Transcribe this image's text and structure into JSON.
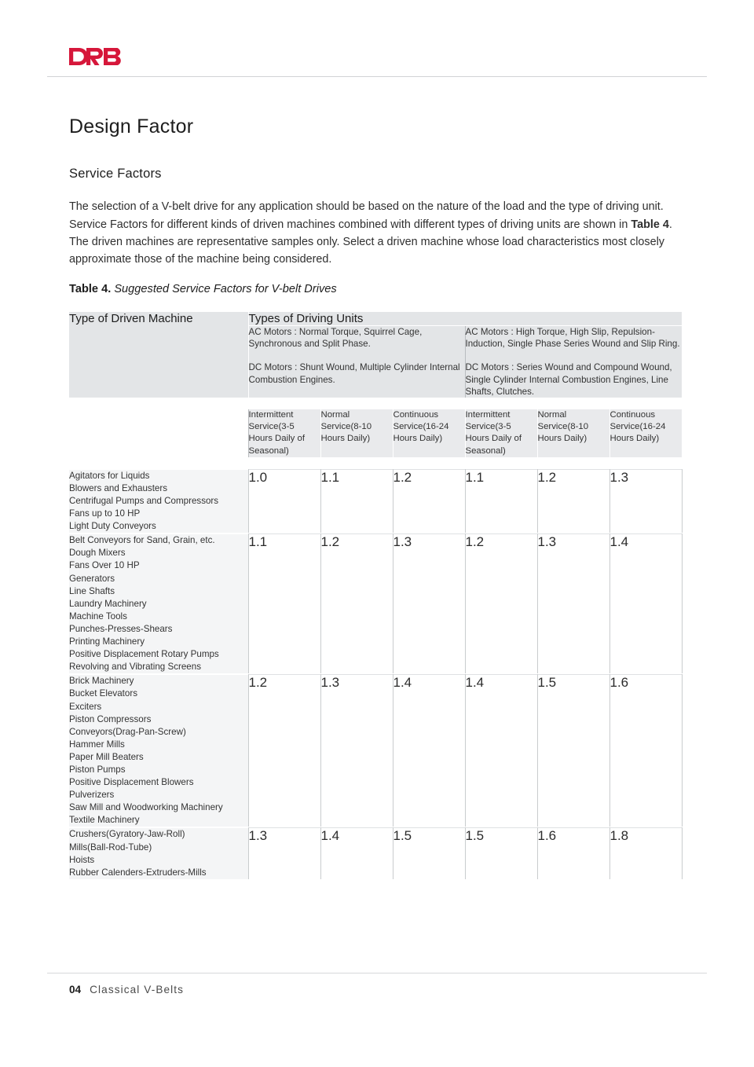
{
  "brand": {
    "logo_text": "DRB",
    "logo_color": "#d6173a"
  },
  "header": {
    "page_title": "Design Factor",
    "section_title": "Service Factors"
  },
  "intro": {
    "part1": "The selection of a V-belt drive for any application should be based on the nature of the load and the type of driving unit. Service Factors for different kinds of driven machines combined with different types of driving units are shown in ",
    "emphasis": "Table 4",
    "part2": ". The driven machines are representative samples only. Select a driven machine whose load characteristics most closely approximate those of the machine being considered."
  },
  "table_caption": {
    "label": "Table 4.",
    "text": " Suggested Service Factors for V-belt Drives"
  },
  "table": {
    "corner_label": "Type of Driven Machine",
    "driving_units_title": "Types of Driving Units",
    "groups": [
      {
        "ac_line": "AC Motors : Normal Torque, Squirrel Cage, Synchronous and Split Phase.",
        "dc_line": "DC Motors : Shunt Wound, Multiple Cylinder Internal Combustion Engines."
      },
      {
        "ac_line": "AC Motors : High Torque, High Slip, Repulsion-Induction, Single Phase Series Wound and Slip Ring.",
        "dc_line": "DC Motors : Series Wound and Compound Wound, Single Cylinder Internal Combustion Engines, Line Shafts, Clutches."
      }
    ],
    "sub_headers": [
      "Intermittent Service(3-5 Hours Daily of Seasonal)",
      "Normal Service(8-10 Hours Daily)",
      "Continuous Service(16-24 Hours Daily)",
      "Intermittent Service(3-5 Hours Daily of Seasonal)",
      "Normal Service(8-10 Hours Daily)",
      "Continuous Service(16-24 Hours Daily)"
    ],
    "rows": [
      {
        "machines": [
          "Agitators for Liquids",
          "Blowers and Exhausters",
          "Centrifugal Pumps and Compressors",
          "Fans up to 10 HP",
          "Light Duty Conveyors"
        ],
        "values": [
          "1.0",
          "1.1",
          "1.2",
          "1.1",
          "1.2",
          "1.3"
        ]
      },
      {
        "machines": [
          "Belt Conveyors for Sand, Grain, etc.",
          "Dough Mixers",
          "Fans Over 10 HP",
          "Generators",
          "Line Shafts",
          "Laundry Machinery",
          "Machine Tools",
          "Punches-Presses-Shears",
          "Printing Machinery",
          "Positive Displacement Rotary Pumps",
          "Revolving and Vibrating Screens"
        ],
        "values": [
          "1.1",
          "1.2",
          "1.3",
          "1.2",
          "1.3",
          "1.4"
        ]
      },
      {
        "machines": [
          "Brick Machinery",
          "Bucket Elevators",
          "Exciters",
          "Piston Compressors",
          "Conveyors(Drag-Pan-Screw)",
          "Hammer Mills",
          "Paper Mill Beaters",
          "Piston Pumps",
          "Positive Displacement Blowers",
          "Pulverizers",
          "Saw Mill and Woodworking Machinery",
          "Textile Machinery"
        ],
        "values": [
          "1.2",
          "1.3",
          "1.4",
          "1.4",
          "1.5",
          "1.6"
        ]
      },
      {
        "machines": [
          "Crushers(Gyratory-Jaw-Roll)",
          "Mills(Ball-Rod-Tube)",
          "Hoists",
          "Rubber Calenders-Extruders-Mills"
        ],
        "values": [
          "1.3",
          "1.4",
          "1.5",
          "1.5",
          "1.6",
          "1.8"
        ]
      }
    ]
  },
  "footer": {
    "page_number": "04",
    "document_title": "Classical V-Belts"
  }
}
